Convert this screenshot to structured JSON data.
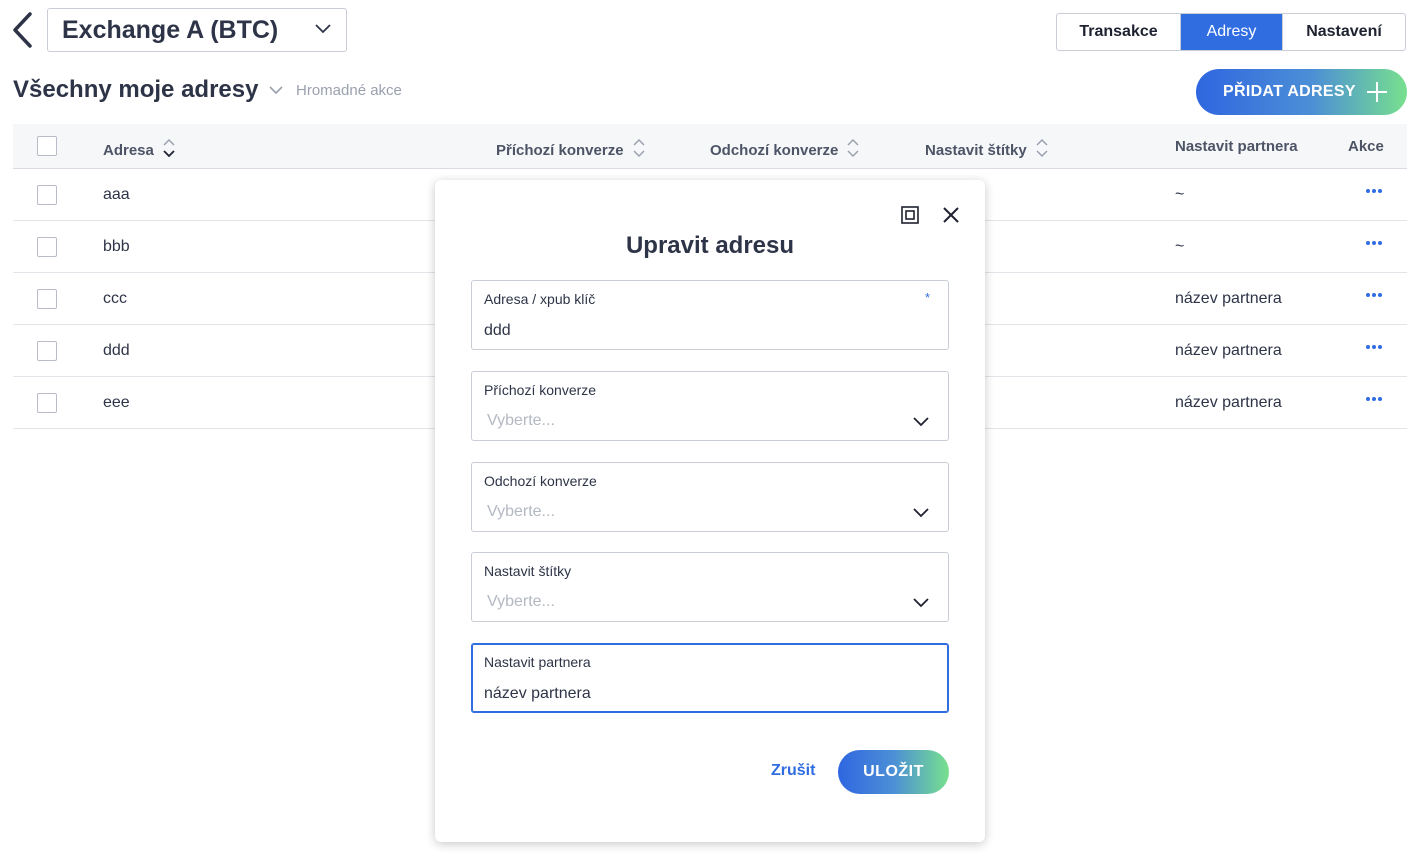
{
  "header": {
    "account_label": "Exchange A (BTC)",
    "tabs": [
      {
        "label": "Transakce",
        "active": false
      },
      {
        "label": "Adresy",
        "active": true
      },
      {
        "label": "Nastavení",
        "active": false
      }
    ],
    "page_title": "Všechny moje adresy",
    "bulk_actions": "Hromadné akce",
    "add_button": "PŘIDAT ADRESY"
  },
  "table": {
    "columns": {
      "address": "Adresa",
      "incoming": "Příchozí konverze",
      "outgoing": "Odchozí konverze",
      "labels": "Nastavit štítky",
      "partner": "Nastavit partnera",
      "actions": "Akce"
    },
    "rows": [
      {
        "address": "aaa",
        "partner": "~"
      },
      {
        "address": "bbb",
        "partner": "~"
      },
      {
        "address": "ccc",
        "partner": "název partnera"
      },
      {
        "address": "ddd",
        "partner": "název partnera"
      },
      {
        "address": "eee",
        "partner": "název partnera"
      }
    ]
  },
  "modal": {
    "title": "Upravit adresu",
    "fields": {
      "address": {
        "label": "Adresa / xpub klíč",
        "value": "ddd",
        "required_mark": "*"
      },
      "incoming": {
        "label": "Příchozí konverze",
        "placeholder": "Vyberte..."
      },
      "outgoing": {
        "label": "Odchozí konverze",
        "placeholder": "Vyberte..."
      },
      "labels": {
        "label": "Nastavit štítky",
        "placeholder": "Vyberte..."
      },
      "partner": {
        "label": "Nastavit partnera",
        "value": "název partnera"
      }
    },
    "cancel_label": "Zrušit",
    "save_label": "ULOŽIT"
  },
  "colors": {
    "accent": "#2f6de1",
    "gradient_end": "#78e08e",
    "text": "#2e3447"
  }
}
